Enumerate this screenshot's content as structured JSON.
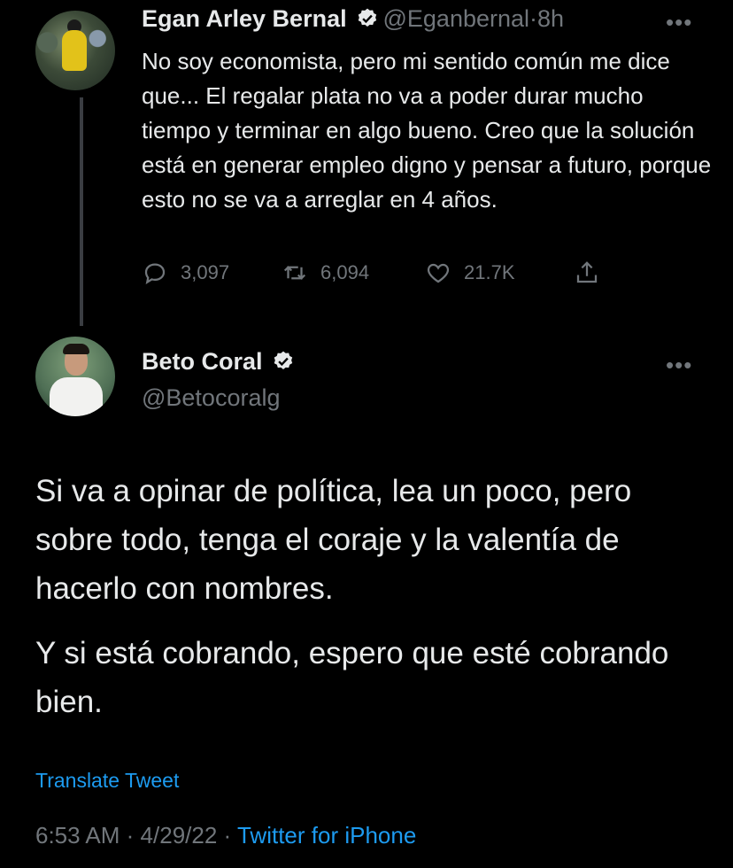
{
  "tweet1": {
    "name": "Egan Arley Bernal",
    "handle": "@Eganbernal",
    "sep": "·",
    "time": "8h",
    "more": "•••",
    "text": "No soy economista, pero mi sentido común me dice que... El regalar plata no va a poder durar mucho tiempo y terminar en algo bueno. Creo que la solución está en generar empleo digno y pensar a futuro, porque esto no se va a arreglar en 4 años.",
    "replies": "3,097",
    "retweets": "6,094",
    "likes": "21.7K"
  },
  "tweet2": {
    "name": "Beto Coral",
    "handle": "@Betocoralg",
    "more": "•••",
    "paragraph1": "Si va a opinar de política, lea un poco, pero sobre todo, tenga el coraje y la valentía de hacerlo con nombres.",
    "paragraph2": "Y si está cobrando, espero que esté cobrando bien.",
    "translate": "Translate Tweet",
    "time": "6:53 AM",
    "date": "4/29/22",
    "source": "Twitter for iPhone"
  },
  "colors": {
    "background": "#000000",
    "text": "#e7e9ea",
    "secondary": "#71767b",
    "accent": "#1d9bf0"
  },
  "icons": [
    "verified-badge-icon",
    "reply-icon",
    "retweet-icon",
    "like-icon",
    "share-icon",
    "more-icon"
  ]
}
